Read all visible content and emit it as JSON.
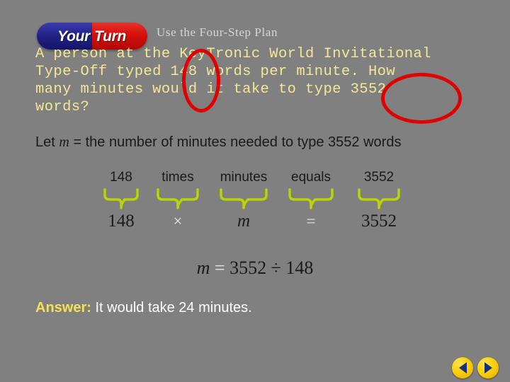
{
  "slide": {
    "background_color": "#808080"
  },
  "header": {
    "badge": {
      "word_1": "Your",
      "word_2": "Turn",
      "left_color": "#23238a",
      "right_color": "#d4100c",
      "text_color": "#ffffff"
    },
    "title": "Use the Four-Step Plan",
    "title_color": "#d6d6d6"
  },
  "problem": {
    "text_color": "#f2e894",
    "line_1": "A person at the KeyTronic World Invitational",
    "line_2": "Type-Off typed 148 words per minute. How",
    "line_3": "many minutes would it take to type 3552",
    "line_4": "words?"
  },
  "annotations": {
    "ellipse_color": "#e00000",
    "circled_1": "148",
    "circled_2": "3552"
  },
  "variable_definition": {
    "prefix": "Let ",
    "variable": "m",
    "suffix": " = the number of minutes needed to type 3552 words"
  },
  "equation_table": {
    "brace_color": "#b9d600",
    "words_row": [
      "148",
      "times",
      "minutes",
      "equals",
      "3552"
    ],
    "symbols_row": [
      "148",
      "×",
      "m",
      "=",
      "3552"
    ]
  },
  "final_equation": {
    "variable": "m",
    "equals": "=",
    "expression": "3552 ÷ 148"
  },
  "answer": {
    "label": "Answer:",
    "label_color": "#f2e05a",
    "text": "It would take 24 minutes.",
    "text_color": "#ffffff"
  },
  "navigation": {
    "previous_label": "previous-slide",
    "next_label": "next-slide",
    "button_color": "#ffd000",
    "arrow_color": "#17307e"
  }
}
